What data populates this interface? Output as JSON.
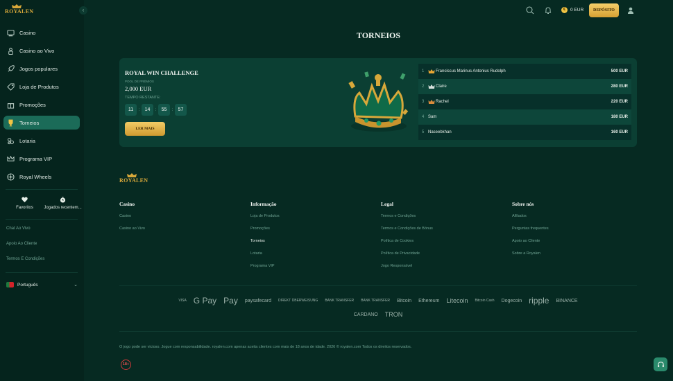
{
  "brand": {
    "name": "ROYALEN",
    "gold": "#d8a83a",
    "accent": "#1b6b58"
  },
  "sidebar": {
    "nav": [
      {
        "label": "Casino",
        "icon": "casino-icon"
      },
      {
        "label": "Casino ao Vivo",
        "icon": "live-casino-icon"
      },
      {
        "label": "Jogos populares",
        "icon": "rocket-icon"
      },
      {
        "label": "Loja de Produtos",
        "icon": "shop-tag-icon"
      },
      {
        "label": "Promoções",
        "icon": "gift-icon"
      },
      {
        "label": "Torneios",
        "icon": "trophy-icon",
        "active": true
      },
      {
        "label": "Lotaria",
        "icon": "lottery-icon"
      },
      {
        "label": "Programa VIP",
        "icon": "crown-icon"
      },
      {
        "label": "Royal Wheels",
        "icon": "wheel-icon"
      }
    ],
    "quick": [
      {
        "label": "Favoritos",
        "icon": "heart-icon"
      },
      {
        "label": "Jogados recentem...",
        "icon": "clock-icon"
      }
    ],
    "links": [
      "Chat Ao Vivo",
      "Apoio Ao Cliente",
      "Termos E Condições"
    ],
    "language": "Português"
  },
  "topbar": {
    "balance": "0 EUR",
    "coin_symbol": "€",
    "deposit_label": "DEPÓSITO"
  },
  "page_title": "TORNEIOS",
  "tournament": {
    "title": "ROYAL WIN CHALLENGE",
    "pool_label": "POOL DE PRÉMIOS",
    "pool_value": "2,000 EUR",
    "time_label": "TEMPO RESTANTE:",
    "timer": [
      "11",
      "14",
      "55",
      "57"
    ],
    "read_more": "LER MAIS",
    "leaderboard": [
      {
        "rank": "1",
        "name": "Franciscus Marinus Antonius Rudolph",
        "prize": "500 EUR",
        "crown": "gold"
      },
      {
        "rank": "2",
        "name": "Claire",
        "prize": "280 EUR",
        "crown": "silver"
      },
      {
        "rank": "3",
        "name": "Rachel",
        "prize": "220 EUR",
        "crown": "bronze"
      },
      {
        "rank": "4",
        "name": "Sam",
        "prize": "180 EUR",
        "crown": ""
      },
      {
        "rank": "5",
        "name": "Naseebkhan",
        "prize": "160 EUR",
        "crown": ""
      }
    ]
  },
  "footer": {
    "columns": [
      {
        "heading": "Casino",
        "links": [
          "Casino",
          "Casino ao Vivo"
        ]
      },
      {
        "heading": "Informação",
        "links": [
          "Loja de Produtos",
          "Promoções",
          "Torneios",
          "Lotaria",
          "Programa VIP"
        ]
      },
      {
        "heading": "Legal",
        "links": [
          "Termos e Condições",
          "Termos e Condições de Bónus",
          "Política de Cookies",
          "Política de Privacidade",
          "Jogo Responsável"
        ]
      },
      {
        "heading": "Sobre nós",
        "links": [
          "Afiliados",
          "Perguntas frequentes",
          "Apoio ao Cliente",
          "Sobre a Royalen"
        ]
      }
    ],
    "payments_row1": [
      "VISA",
      "G Pay",
      " Pay",
      "paysafecard",
      "DIREKT ÜBERWEISUNG",
      "BANK TRANSFER",
      "BANK TRANSFER",
      "Bitcoin",
      "Ethereum",
      "Litecoin",
      "Bitcoin Cash",
      "Dogecoin",
      "ripple",
      "BINANCE"
    ],
    "payments_row2": [
      "CARDANO",
      "TRON"
    ],
    "disclaimer": "O jogo pode ser vicioso. Jogue com responsabilidade. royalen.com apenas aceita clientes com mais de 18 anos de idade. 2026 © royalen.com Todos os direitos reservados.",
    "age_badge": "18+"
  }
}
